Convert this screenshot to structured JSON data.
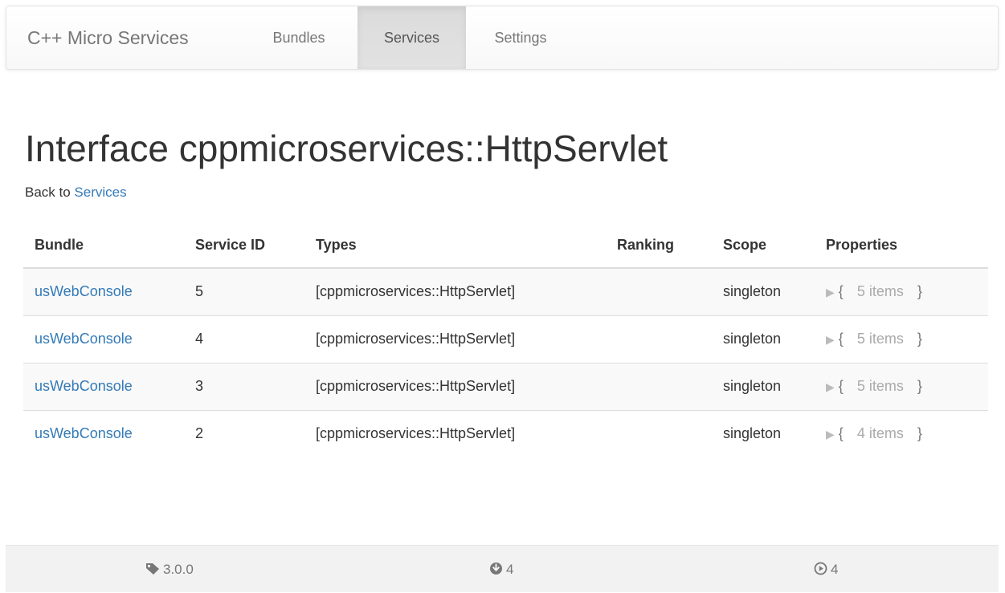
{
  "navbar": {
    "brand": "C++ Micro Services",
    "items": [
      {
        "label": "Bundles",
        "active": false
      },
      {
        "label": "Services",
        "active": true
      },
      {
        "label": "Settings",
        "active": false
      }
    ]
  },
  "page": {
    "title": "Interface cppmicroservices::HttpServlet",
    "back_prefix": "Back to ",
    "back_link": "Services"
  },
  "table": {
    "headers": [
      "Bundle",
      "Service ID",
      "Types",
      "Ranking",
      "Scope",
      "Properties"
    ],
    "rows": [
      {
        "bundle": "usWebConsole",
        "service_id": "5",
        "types": "[cppmicroservices::HttpServlet]",
        "ranking": "",
        "scope": "singleton",
        "properties": "5 items"
      },
      {
        "bundle": "usWebConsole",
        "service_id": "4",
        "types": "[cppmicroservices::HttpServlet]",
        "ranking": "",
        "scope": "singleton",
        "properties": "5 items"
      },
      {
        "bundle": "usWebConsole",
        "service_id": "3",
        "types": "[cppmicroservices::HttpServlet]",
        "ranking": "",
        "scope": "singleton",
        "properties": "5 items"
      },
      {
        "bundle": "usWebConsole",
        "service_id": "2",
        "types": "[cppmicroservices::HttpServlet]",
        "ranking": "",
        "scope": "singleton",
        "properties": "4 items"
      }
    ],
    "property_open": "{",
    "property_close": "}",
    "property_toggle_icon": "triangle-right-icon"
  },
  "footer": {
    "version": "3.0.0",
    "installed_count": "4",
    "active_count": "4",
    "icons": [
      "tag-icon",
      "circle-arrow-down-icon",
      "circle-play-icon"
    ]
  },
  "colors": {
    "link": "#337ab7",
    "nav_text": "#777777",
    "active_nav_bg": "#e0e0e0",
    "footer_bg": "#f2f2f2"
  }
}
